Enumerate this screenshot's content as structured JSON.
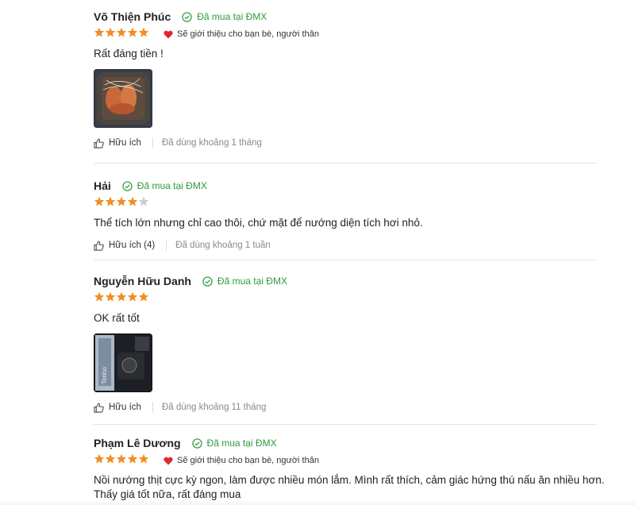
{
  "colors": {
    "star_filled": "#f28e21",
    "star_empty": "#cccccc",
    "bought_green": "#2e9a3c",
    "heart_red": "#e0262c"
  },
  "reviews": [
    {
      "name": "Võ Thiện Phúc",
      "bought": "Đã mua tại ĐMX",
      "rating": 5,
      "recommend": "Sẽ giới thiệu cho bạn bè, người thân",
      "content": "Rất đáng tiền !",
      "has_photo": true,
      "photo_desc": "grilled shrimp in air fryer basket",
      "helpful": "Hữu ích",
      "used": "Đã dùng khoảng 1 tháng"
    },
    {
      "name": "Hải",
      "bought": "Đã mua tại ĐMX",
      "rating": 4,
      "recommend": "",
      "content": "Thể tích lớn nhưng chỉ cao thôi, chứ mặt để nướng diện tích hơi nhỏ.",
      "has_photo": false,
      "helpful": "Hữu ích (4)",
      "used": "Đã dùng khoảng 1 tuần"
    },
    {
      "name": "Nguyễn Hữu Danh",
      "bought": "Đã mua tại ĐMX",
      "rating": 5,
      "recommend": "",
      "content": "OK rất tốt",
      "has_photo": true,
      "photo_desc": "appliance in a dark room",
      "photo_text": "Torino",
      "helpful": "Hữu ích",
      "used": "Đã dùng khoảng 11 tháng"
    },
    {
      "name": "Phạm Lê Dương",
      "bought": "Đã mua tại ĐMX",
      "rating": 5,
      "recommend": "Sẽ giới thiệu cho bạn bè, người thân",
      "content": "Nồi nướng thịt cực kỳ ngon, làm được nhiều món lắm. Mình rất thích, cảm giác hứng thú nấu ăn nhiều hơn. Thấy giá tốt nữa, rất đáng mua"
    }
  ]
}
